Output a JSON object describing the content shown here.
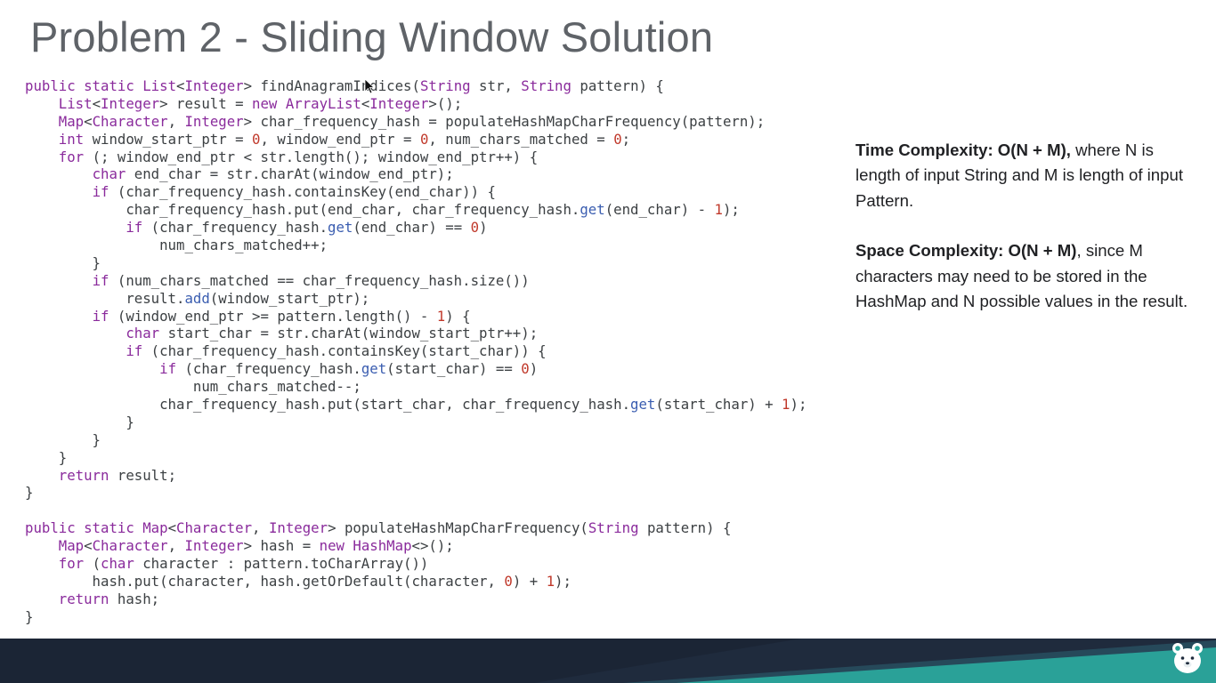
{
  "slide": {
    "title": "Problem 2 - Sliding Window Solution"
  },
  "code": {
    "lines": [
      [
        [
          "kw",
          "public static "
        ],
        [
          "ty",
          "List"
        ],
        [
          "p",
          "<"
        ],
        [
          "ty",
          "Integer"
        ],
        [
          "p",
          "> findAnagramIndices("
        ],
        [
          "ty",
          "String"
        ],
        [
          "p",
          " str, "
        ],
        [
          "ty",
          "String"
        ],
        [
          "p",
          " pattern) {"
        ]
      ],
      [
        [
          "p",
          "    "
        ],
        [
          "ty",
          "List"
        ],
        [
          "p",
          "<"
        ],
        [
          "ty",
          "Integer"
        ],
        [
          "p",
          "> result = "
        ],
        [
          "kw",
          "new "
        ],
        [
          "ty",
          "ArrayList"
        ],
        [
          "p",
          "<"
        ],
        [
          "ty",
          "Integer"
        ],
        [
          "p",
          ">();"
        ]
      ],
      [
        [
          "p",
          "    "
        ],
        [
          "ty",
          "Map"
        ],
        [
          "p",
          "<"
        ],
        [
          "ty",
          "Character"
        ],
        [
          "p",
          ", "
        ],
        [
          "ty",
          "Integer"
        ],
        [
          "p",
          "> char_frequency_hash = populateHashMapCharFrequency(pattern);"
        ]
      ],
      [
        [
          "p",
          "    "
        ],
        [
          "kw",
          "int"
        ],
        [
          "p",
          " window_start_ptr = "
        ],
        [
          "num",
          "0"
        ],
        [
          "p",
          ", window_end_ptr = "
        ],
        [
          "num",
          "0"
        ],
        [
          "p",
          ", num_chars_matched = "
        ],
        [
          "num",
          "0"
        ],
        [
          "p",
          ";"
        ]
      ],
      [
        [
          "p",
          "    "
        ],
        [
          "kw",
          "for"
        ],
        [
          "p",
          " (; window_end_ptr < str.length(); window_end_ptr++) {"
        ]
      ],
      [
        [
          "p",
          "        "
        ],
        [
          "kw",
          "char"
        ],
        [
          "p",
          " end_char = str.charAt(window_end_ptr);"
        ]
      ],
      [
        [
          "p",
          "        "
        ],
        [
          "kw",
          "if"
        ],
        [
          "p",
          " (char_frequency_hash.containsKey(end_char)) {"
        ]
      ],
      [
        [
          "p",
          "            char_frequency_hash.put(end_char, char_frequency_hash."
        ],
        [
          "m",
          "get"
        ],
        [
          "p",
          "(end_char) - "
        ],
        [
          "num",
          "1"
        ],
        [
          "p",
          ");"
        ]
      ],
      [
        [
          "p",
          "            "
        ],
        [
          "kw",
          "if"
        ],
        [
          "p",
          " (char_frequency_hash."
        ],
        [
          "m",
          "get"
        ],
        [
          "p",
          "(end_char) == "
        ],
        [
          "num",
          "0"
        ],
        [
          "p",
          ")"
        ]
      ],
      [
        [
          "p",
          "                num_chars_matched++;"
        ]
      ],
      [
        [
          "p",
          "        }"
        ]
      ],
      [
        [
          "p",
          "        "
        ],
        [
          "kw",
          "if"
        ],
        [
          "p",
          " (num_chars_matched == char_frequency_hash.size())"
        ]
      ],
      [
        [
          "p",
          "            result."
        ],
        [
          "m",
          "add"
        ],
        [
          "p",
          "(window_start_ptr);"
        ]
      ],
      [
        [
          "p",
          "        "
        ],
        [
          "kw",
          "if"
        ],
        [
          "p",
          " (window_end_ptr >= pattern.length() - "
        ],
        [
          "num",
          "1"
        ],
        [
          "p",
          ") {"
        ]
      ],
      [
        [
          "p",
          "            "
        ],
        [
          "kw",
          "char"
        ],
        [
          "p",
          " start_char = str.charAt(window_start_ptr++);"
        ]
      ],
      [
        [
          "p",
          "            "
        ],
        [
          "kw",
          "if"
        ],
        [
          "p",
          " (char_frequency_hash.containsKey(start_char)) {"
        ]
      ],
      [
        [
          "p",
          "                "
        ],
        [
          "kw",
          "if"
        ],
        [
          "p",
          " (char_frequency_hash."
        ],
        [
          "m",
          "get"
        ],
        [
          "p",
          "(start_char) == "
        ],
        [
          "num",
          "0"
        ],
        [
          "p",
          ")"
        ]
      ],
      [
        [
          "p",
          "                    num_chars_matched--;"
        ]
      ],
      [
        [
          "p",
          "                char_frequency_hash.put(start_char, char_frequency_hash."
        ],
        [
          "m",
          "get"
        ],
        [
          "p",
          "(start_char) + "
        ],
        [
          "num",
          "1"
        ],
        [
          "p",
          ");"
        ]
      ],
      [
        [
          "p",
          "            }"
        ]
      ],
      [
        [
          "p",
          "        }"
        ]
      ],
      [
        [
          "p",
          "    }"
        ]
      ],
      [
        [
          "p",
          "    "
        ],
        [
          "kw",
          "return"
        ],
        [
          "p",
          " result;"
        ]
      ],
      [
        [
          "p",
          "}"
        ]
      ],
      [
        [
          "p",
          ""
        ]
      ],
      [
        [
          "kw",
          "public static "
        ],
        [
          "ty",
          "Map"
        ],
        [
          "p",
          "<"
        ],
        [
          "ty",
          "Character"
        ],
        [
          "p",
          ", "
        ],
        [
          "ty",
          "Integer"
        ],
        [
          "p",
          "> populateHashMapCharFrequency("
        ],
        [
          "ty",
          "String"
        ],
        [
          "p",
          " pattern) {"
        ]
      ],
      [
        [
          "p",
          "    "
        ],
        [
          "ty",
          "Map"
        ],
        [
          "p",
          "<"
        ],
        [
          "ty",
          "Character"
        ],
        [
          "p",
          ", "
        ],
        [
          "ty",
          "Integer"
        ],
        [
          "p",
          "> hash = "
        ],
        [
          "kw",
          "new "
        ],
        [
          "ty",
          "HashMap"
        ],
        [
          "p",
          "<>();"
        ]
      ],
      [
        [
          "p",
          "    "
        ],
        [
          "kw",
          "for"
        ],
        [
          "p",
          " ("
        ],
        [
          "kw",
          "char"
        ],
        [
          "p",
          " character : pattern.toCharArray())"
        ]
      ],
      [
        [
          "p",
          "        hash.put(character, hash.getOrDefault(character, "
        ],
        [
          "num",
          "0"
        ],
        [
          "p",
          ") + "
        ],
        [
          "num",
          "1"
        ],
        [
          "p",
          ");"
        ]
      ],
      [
        [
          "p",
          "    "
        ],
        [
          "kw",
          "return"
        ],
        [
          "p",
          " hash;"
        ]
      ],
      [
        [
          "p",
          "}"
        ]
      ]
    ]
  },
  "complexity": {
    "time_label": "Time Complexity: O(N + M),",
    "time_text": " where N is length of input String and M is length of input Pattern.",
    "space_label": "Space Complexity: O(N + M)",
    "space_text": ", since M characters may need to be stored in the HashMap and N possible values in the result."
  },
  "colors": {
    "keyword": "#8a2b9c",
    "number": "#c0392b",
    "method": "#3a5db0",
    "plain": "#3c4043",
    "title": "#5f6368",
    "footer_dark": "#1f2b3d",
    "footer_teal": "#2aa198"
  },
  "icons": {
    "cursor": "mouse-pointer-icon",
    "logo": "bear-logo-icon"
  }
}
